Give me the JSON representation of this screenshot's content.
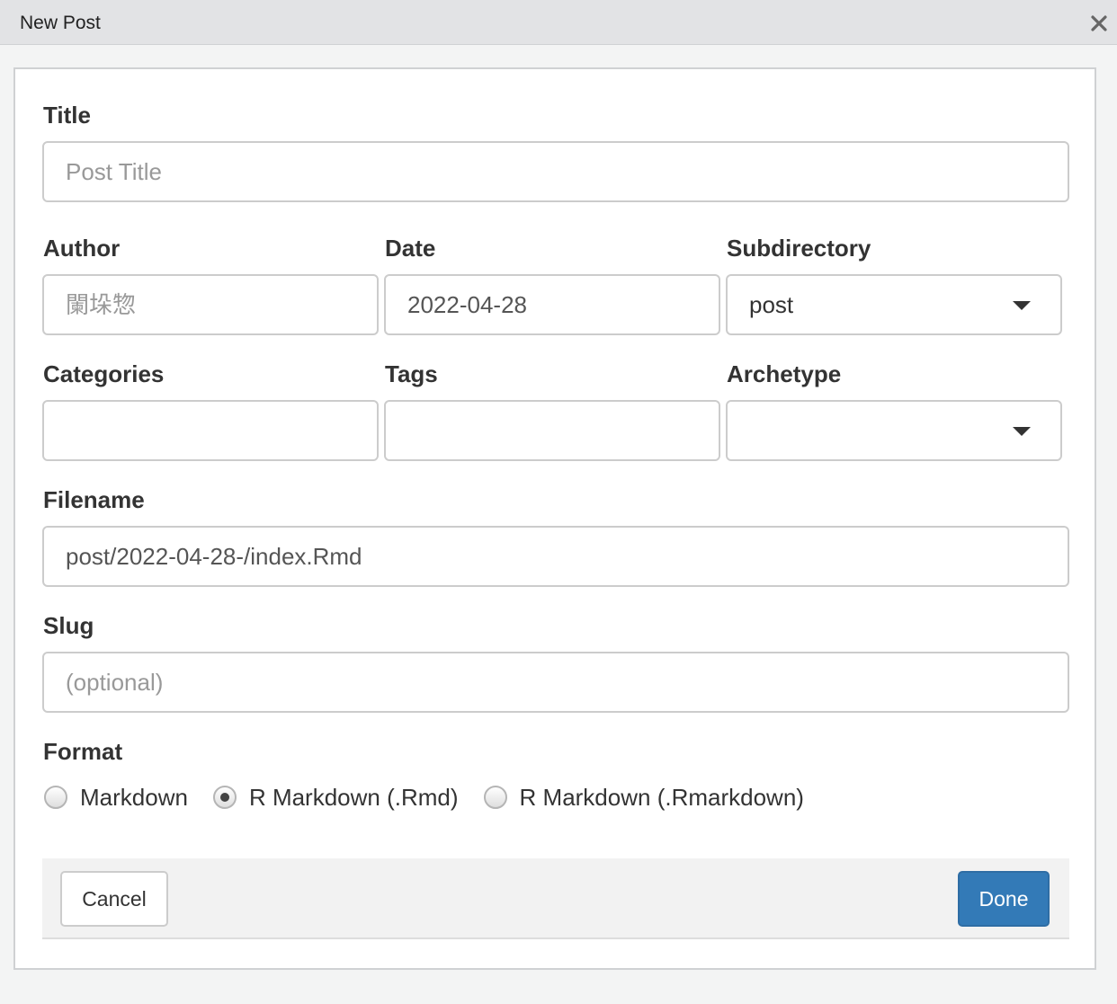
{
  "window": {
    "title": "New Post",
    "close_icon": "close-icon"
  },
  "form": {
    "title": {
      "label": "Title",
      "value": "",
      "placeholder": "Post Title"
    },
    "author": {
      "label": "Author",
      "value": "",
      "placeholder": "闌垛惣"
    },
    "date": {
      "label": "Date",
      "value": "2022-04-28"
    },
    "subdirectory": {
      "label": "Subdirectory",
      "selected": "post"
    },
    "categories": {
      "label": "Categories",
      "value": ""
    },
    "tags": {
      "label": "Tags",
      "value": ""
    },
    "archetype": {
      "label": "Archetype",
      "selected": ""
    },
    "filename": {
      "label": "Filename",
      "value": "post/2022-04-28-/index.Rmd"
    },
    "slug": {
      "label": "Slug",
      "value": "",
      "placeholder": "(optional)"
    },
    "format": {
      "label": "Format",
      "options": [
        {
          "label": "Markdown",
          "checked": false
        },
        {
          "label": "R Markdown (.Rmd)",
          "checked": true
        },
        {
          "label": "R Markdown (.Rmarkdown)",
          "checked": false
        }
      ]
    }
  },
  "footer": {
    "cancel_label": "Cancel",
    "done_label": "Done"
  },
  "colors": {
    "primary": "#337ab7",
    "titlebar": "#e2e3e5"
  }
}
